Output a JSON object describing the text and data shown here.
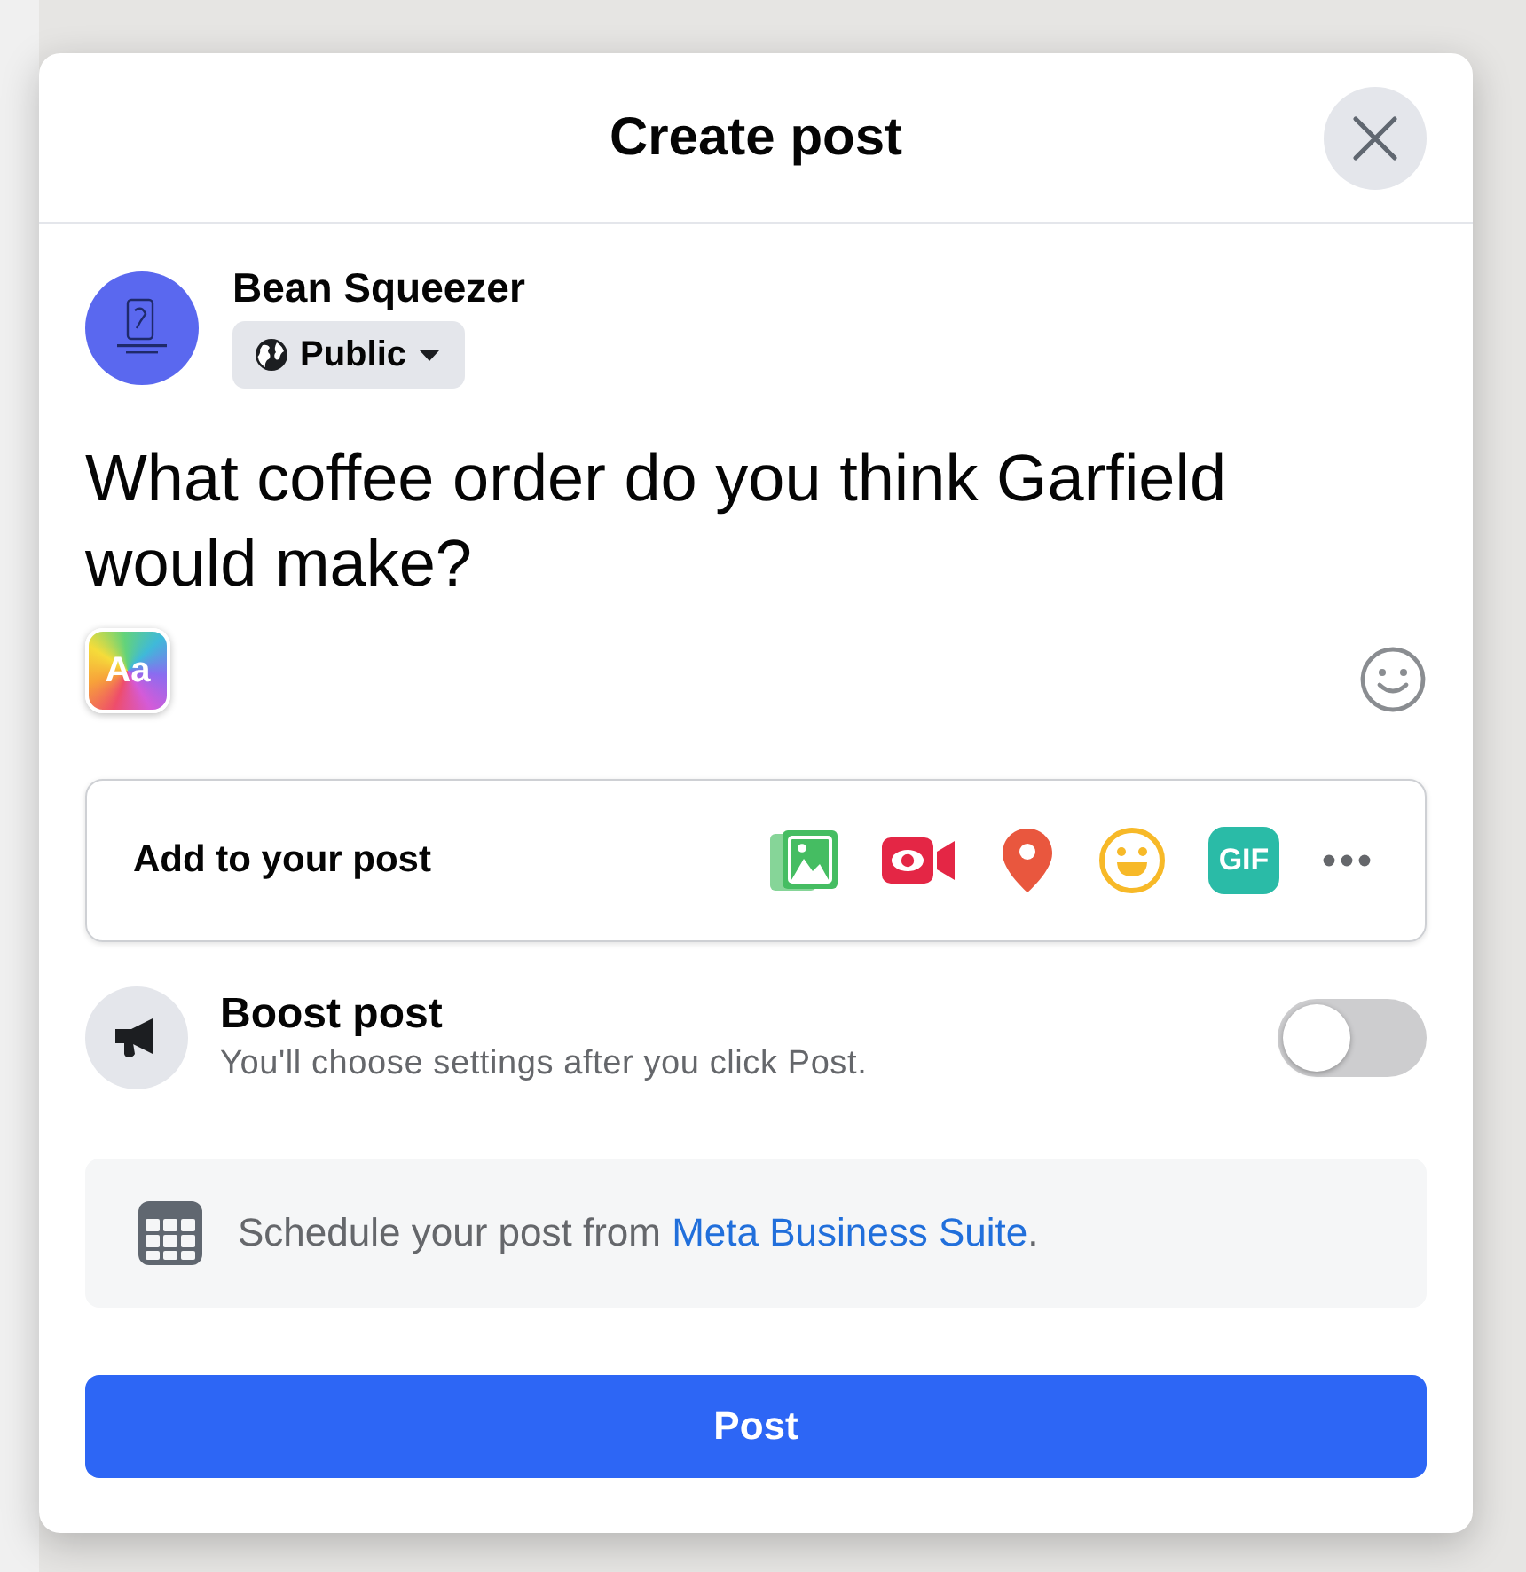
{
  "dialog": {
    "title": "Create post"
  },
  "author": {
    "name": "Bean Squeezer",
    "audience": "Public"
  },
  "composer": {
    "value": "What coffee order do you think Garfield would make?",
    "format_button": "Aa"
  },
  "add_to_post": {
    "label": "Add to your post",
    "tools": [
      {
        "kind": "photo"
      },
      {
        "kind": "video"
      },
      {
        "kind": "location"
      },
      {
        "kind": "feeling"
      },
      {
        "kind": "gif",
        "label": "GIF"
      },
      {
        "kind": "more"
      }
    ]
  },
  "boost": {
    "title": "Boost post",
    "subtitle": "You'll choose settings after you click Post.",
    "on": false
  },
  "schedule": {
    "text": "Schedule your post from",
    "link": "Meta Business Suite",
    "suffix": "."
  },
  "submit_button": "Post"
}
